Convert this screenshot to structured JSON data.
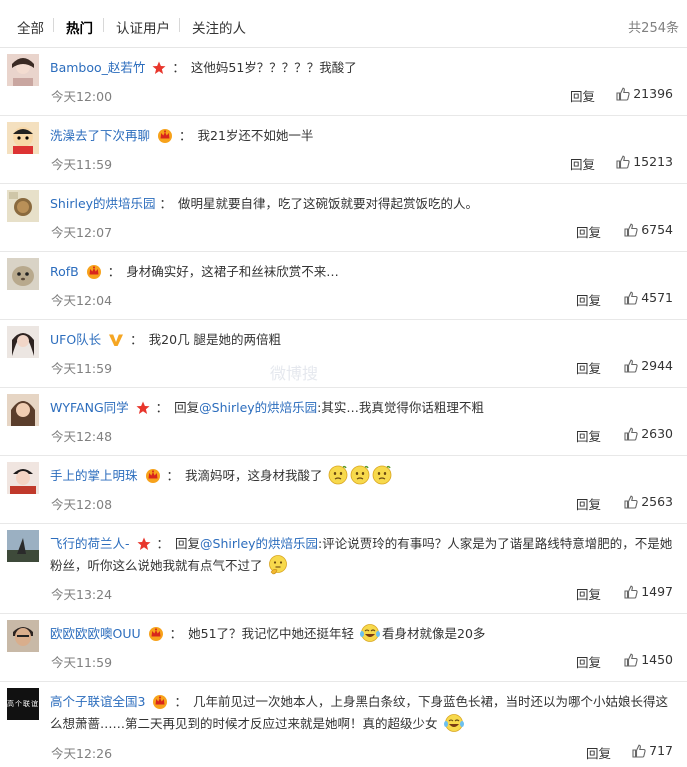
{
  "tabs": [
    "全部",
    "热门",
    "认证用户",
    "关注的人"
  ],
  "active_tab": "热门",
  "total": "共254条",
  "reply_label": "回复",
  "comments": [
    {
      "user": "Bamboo_赵若竹",
      "badge": "star",
      "text": "这他妈51岁？？？？？我酸了",
      "time": "今天12:00",
      "likes": "21396"
    },
    {
      "user": "洗澡去了下次再聊",
      "badge": "crown",
      "text": "我21岁还不如她一半",
      "time": "今天11:59",
      "likes": "15213"
    },
    {
      "user": "Shirley的烘培乐园",
      "badge": "",
      "text": "做明星就要自律，吃了这碗饭就要对得起赏饭吃的人。",
      "time": "今天12:07",
      "likes": "6754"
    },
    {
      "user": "RofB",
      "badge": "crown",
      "text": "身材确实好，这裙子和丝袜欣赏不来…",
      "time": "今天12:04",
      "likes": "4571"
    },
    {
      "user": "UFO队长",
      "badge": "vip",
      "text": "我20几 腿是她的两倍粗",
      "time": "今天11:59",
      "likes": "2944"
    },
    {
      "user": "WYFANG同学",
      "badge": "star",
      "prefix": "回复",
      "mention": "@Shirley的烘焙乐园",
      "text": ":其实…我真觉得你话粗理不粗",
      "time": "今天12:48",
      "likes": "2630"
    },
    {
      "user": "手上的掌上明珠",
      "badge": "crown",
      "text": "我滴妈呀，这身材我酸了",
      "time": "今天12:08",
      "likes": "2563"
    },
    {
      "user": "飞行的荷兰人-",
      "badge": "star",
      "prefix": "回复",
      "mention": "@Shirley的烘焙乐园",
      "text": ":评论说贾玲的有事吗？人家是为了谐星路线特意增肥的，不是她粉丝，听你这么说她我就有点气不过了",
      "time": "今天13:24",
      "likes": "1497"
    },
    {
      "user": "欧欧欧欧噢OUU",
      "badge": "crown",
      "text": "她51了？我记忆中她还挺年轻",
      "text2": "看身材就像是20多",
      "time": "今天11:59",
      "likes": "1450"
    },
    {
      "user": "高个子联谊全国3",
      "badge": "crown",
      "text": "几年前见过一次她本人，上身黑白条纹，下身蓝色长裙，当时还以为哪个小姑娘长得这么想萧蔷……第二天再见到的时候才反应过来就是她啊！真的超级少女",
      "time": "今天12:26",
      "likes": "717",
      "avatar_text": "高个联谊"
    }
  ],
  "watermark": "微博搜"
}
